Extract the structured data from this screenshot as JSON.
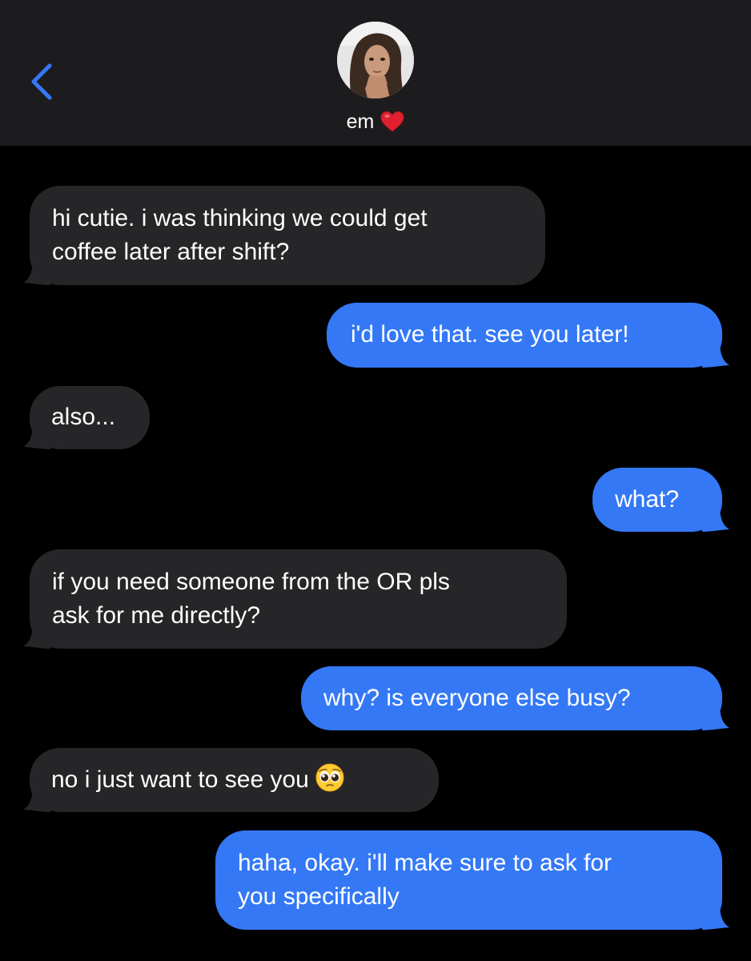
{
  "header": {
    "contact_name": "em",
    "contact_emoji": "red-heart-icon",
    "back_icon": "chevron-left-icon",
    "accent_color": "#3478f6",
    "background": "#1c1c1e"
  },
  "colors": {
    "incoming_bubble": "#262628",
    "outgoing_bubble": "#3478f6",
    "background": "#000000"
  },
  "messages": [
    {
      "direction": "incoming",
      "text": "hi cutie. i was thinking we could get\ncoffee later after shift?"
    },
    {
      "direction": "outgoing",
      "text": "i'd love that. see you later!"
    },
    {
      "direction": "incoming",
      "text": "also..."
    },
    {
      "direction": "outgoing",
      "text": "what?"
    },
    {
      "direction": "incoming",
      "text": "if you need someone from the OR pls\nask for me directly?"
    },
    {
      "direction": "outgoing",
      "text": "why? is everyone else busy?"
    },
    {
      "direction": "incoming",
      "text": "no i just want to see you",
      "emoji": "pleading-face-icon"
    },
    {
      "direction": "outgoing",
      "text": "haha, okay. i'll make sure to ask for\nyou specifically"
    }
  ]
}
